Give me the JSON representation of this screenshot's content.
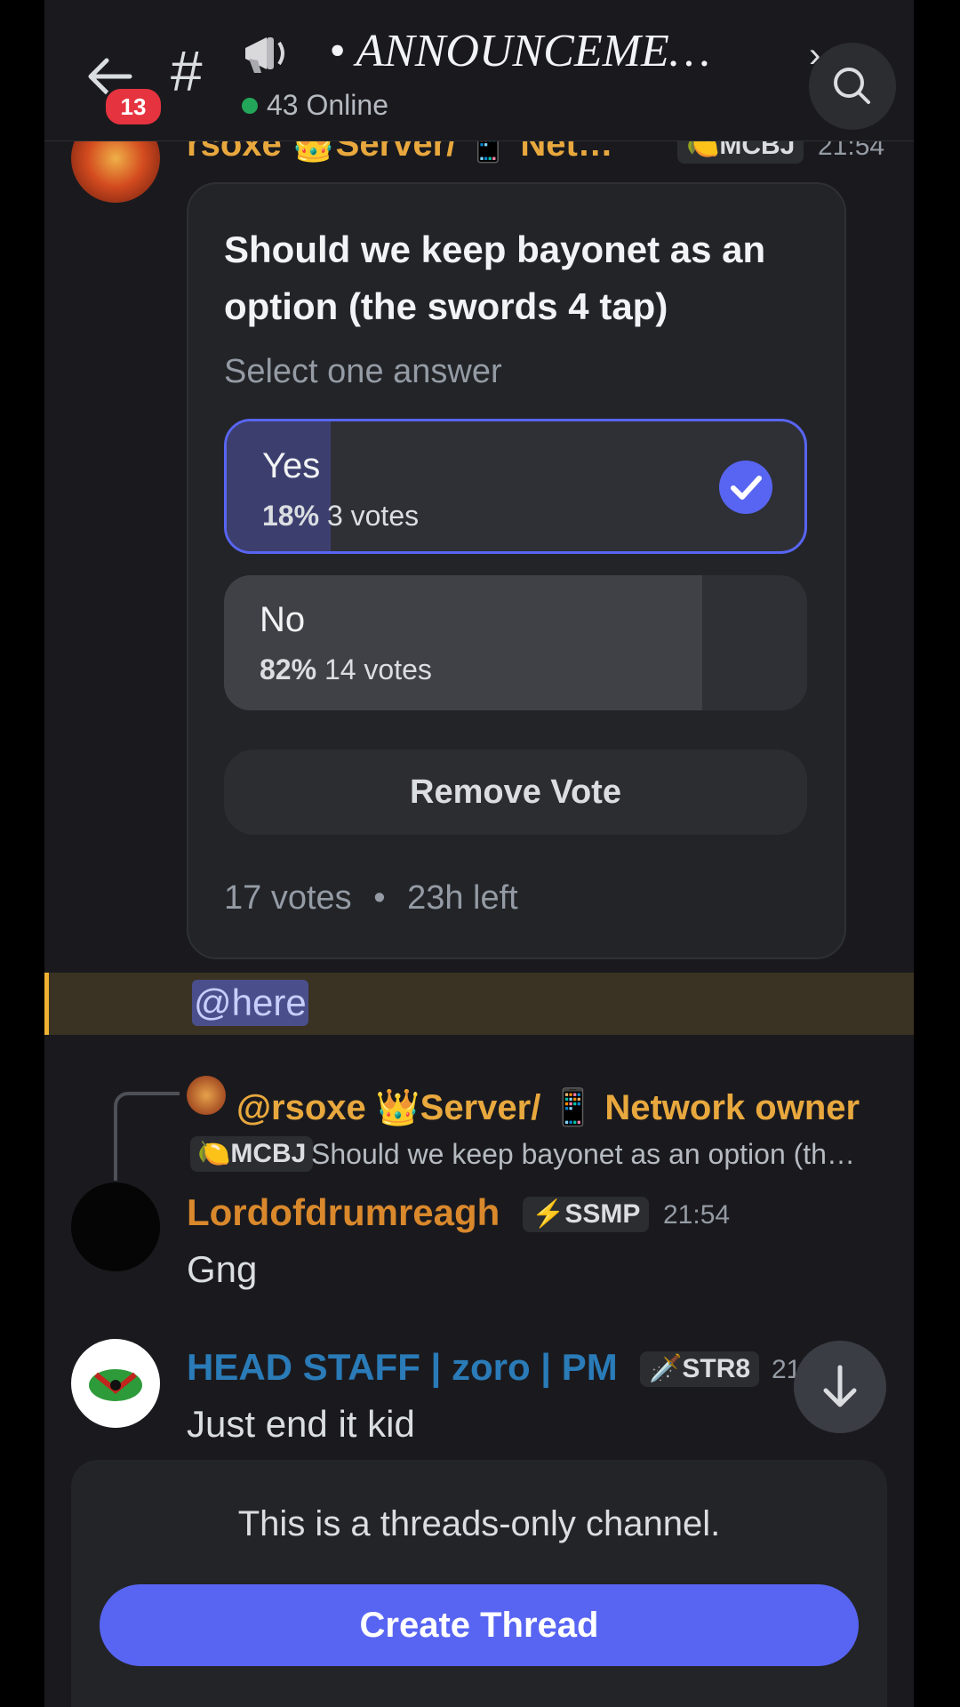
{
  "header": {
    "unread_badge": "13",
    "hash": "#",
    "channel_title": "• ANNOUNCEME…",
    "chevron": "›",
    "online": "43 Online"
  },
  "message1": {
    "username": "rsoxe 👑Server/ 📱 Net…",
    "tag": "🍋MCBJ",
    "time": "21:54"
  },
  "poll": {
    "question": "Should we keep bayonet as an option (the swords 4 tap)",
    "subtitle": "Select one answer",
    "options": [
      {
        "label": "Yes",
        "percent": "18%",
        "votes": "3 votes",
        "fraction": 0.18,
        "selected": true
      },
      {
        "label": "No",
        "percent": "82%",
        "votes": "14 votes",
        "fraction": 0.82,
        "selected": false
      }
    ],
    "remove_label": "Remove Vote",
    "footer_votes": "17 votes",
    "footer_sep": "•",
    "footer_time": "23h left"
  },
  "mention": "@here",
  "reply": {
    "name": "@rsoxe 👑Server/ 📱 Network owner",
    "tag": "🍋MCBJ",
    "text": "Should we keep bayonet as an option (th…"
  },
  "message2": {
    "username": "Lordofdrumreagh",
    "tag": "⚡SSMP",
    "time": "21:54",
    "text": "Gng"
  },
  "message3": {
    "username": "HEAD STAFF | zoro | PM",
    "tag": "🗡️STR8",
    "time": "21",
    "text": "Just end it kid"
  },
  "bottom": {
    "notice": "This is a threads-only channel.",
    "button": "Create Thread"
  },
  "colors": {
    "accent": "#5865f2",
    "background": "#1a1a1e",
    "mention_highlight": "#f0b232"
  }
}
